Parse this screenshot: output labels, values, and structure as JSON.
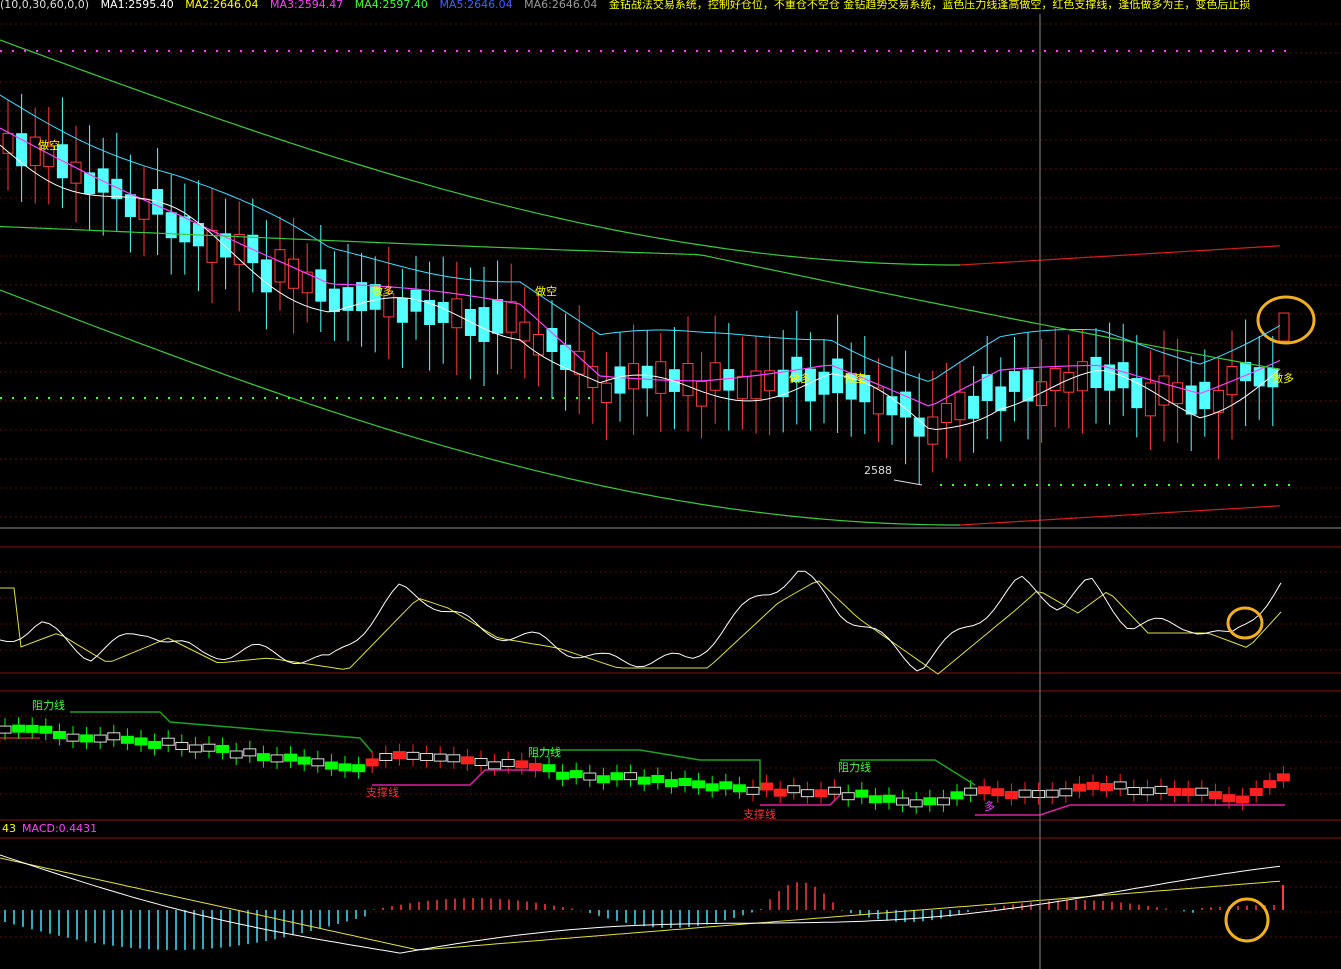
{
  "header": {
    "params": "(10,0,30,60,0,0)",
    "ma1": "MA1:2595.40",
    "ma2": "MA2:2646.04",
    "ma3": "MA3:2594.47",
    "ma4": "MA4:2597.40",
    "ma5": "MA5:2646.04",
    "ma6": "MA6:2646.04",
    "description": "金钻战法交易系统，控制好仓位，不重仓不空仓 金钻趋势交易系统，蓝色压力线逢高做空，红色支撑线，逢低做多为主，变色后止损"
  },
  "main_chart": {
    "signal_labels": [
      "做空",
      "做多",
      "做空",
      "做多",
      "做空",
      "做多"
    ],
    "low_price_label": "2588"
  },
  "osc_panel": {},
  "trend_panel": {
    "resistance_labels": [
      "阻力线",
      "阻力线",
      "阻力线"
    ],
    "support_labels": [
      "支撑线",
      "支撑线"
    ],
    "long_label": "多"
  },
  "macd_panel": {
    "left_value": "43",
    "macd_label": "MACD:0.4431"
  },
  "colors": {
    "up_candle": "#ff3c3c",
    "down_candle": "#54ffff",
    "ma_white": "#ffffff",
    "ma_magenta": "#ff40ff",
    "ma_green": "#3cc83c",
    "band_red": "#d02020",
    "signal_yellow": "#ffff00",
    "highlight_circle": "#f0b020",
    "trend_green": "#00ff00",
    "trend_red": "#ff2020",
    "support_magenta": "#e020a0",
    "resist_green": "#20a020"
  }
}
